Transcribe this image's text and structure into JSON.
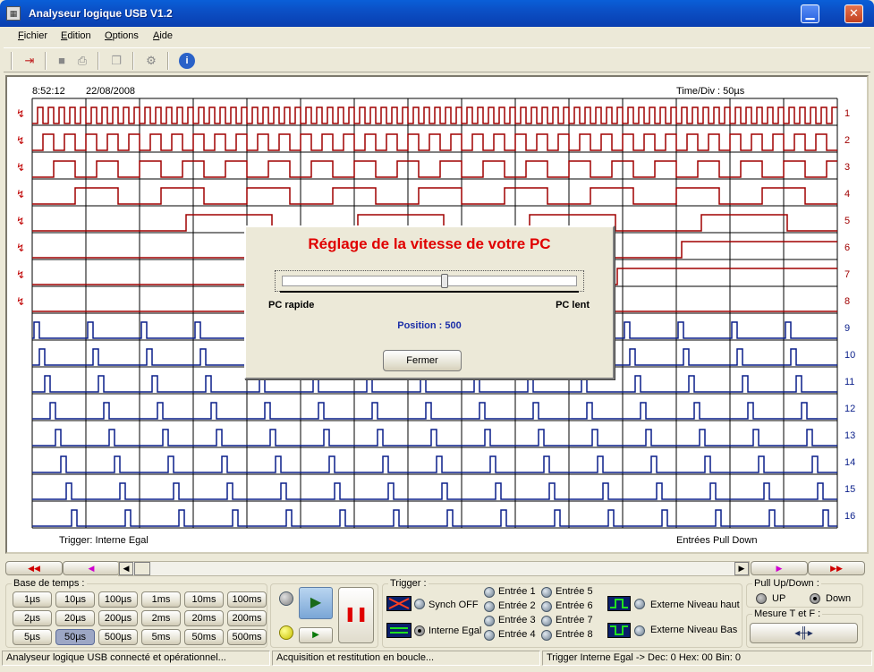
{
  "window": {
    "title": "Analyseur logique USB V1.2",
    "minimize": "▁",
    "close": "✕"
  },
  "menu": [
    "Fichier",
    "Edition",
    "Options",
    "Aide"
  ],
  "scope": {
    "time": "8:52:12",
    "date": "22/08/2008",
    "time_div": "Time/Div : 50µs",
    "trigger_label": "Trigger: Interne Egal",
    "inputs_label": "Entrées Pull Down",
    "channels": [
      "1",
      "2",
      "3",
      "4",
      "5",
      "6",
      "7",
      "8",
      "9",
      "10",
      "11",
      "12",
      "13",
      "14",
      "15",
      "16"
    ],
    "colors": {
      "upper": "#a00000",
      "lower": "#0a1f8a",
      "grid": "#000000"
    }
  },
  "dialog": {
    "title": "Réglage de la vitesse de votre PC",
    "left_label": "PC rapide",
    "right_label": "PC lent",
    "position_label": "Position : 500",
    "slider_fraction": 0.5,
    "button": "Fermer"
  },
  "nav": {
    "first": "◀◀",
    "prev": "◀",
    "next": "▶",
    "last": "▶▶"
  },
  "timebase": {
    "label": "Base de temps :",
    "buttons": [
      "1µs",
      "10µs",
      "100µs",
      "1ms",
      "10ms",
      "100ms",
      "2µs",
      "20µs",
      "200µs",
      "2ms",
      "20ms",
      "200ms",
      "5µs",
      "50µs",
      "500µs",
      "5ms",
      "50ms",
      "500ms"
    ],
    "selected": "50µs"
  },
  "trigger": {
    "label": "Trigger :",
    "synch": "Synch OFF",
    "interne": "Interne Egal",
    "entrees": [
      "Entrée 1",
      "Entrée 2",
      "Entrée 3",
      "Entrée 4",
      "Entrée 5",
      "Entrée 6",
      "Entrée 7",
      "Entrée 8"
    ],
    "ext_haut": "Externe Niveau haut",
    "ext_bas": "Externe Niveau Bas"
  },
  "pull": {
    "label": "Pull Up/Down :",
    "up": "UP",
    "down": "Down"
  },
  "mesure": {
    "label": "Mesure T et F :"
  },
  "status": {
    "left": "Analyseur logique USB connecté et opérationnel...",
    "middle": "Acquisition et restitution en boucle...",
    "right": "Trigger Interne Egal -> Dec: 0    Hex: 00   Bin: 0"
  }
}
